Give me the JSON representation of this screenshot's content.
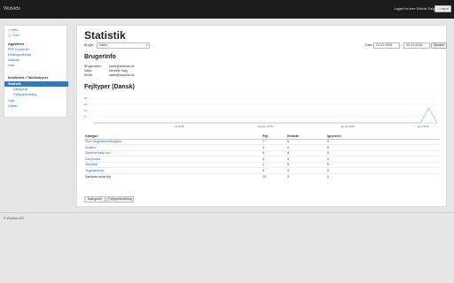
{
  "topbar": {
    "brand": "Wizkids",
    "login_text": "Logget ind som Wizkids Salg",
    "logout_label": "⎋ Log ud"
  },
  "sidebar": {
    "home": "⌂ Hjem",
    "kurv": "🛒 Kurv",
    "section1": "AppWriter",
    "items1": [
      "PDF Konverter",
      "Ordbogsværktøj",
      "Statistik",
      "Hold"
    ],
    "section2": "IntoWords / TaleAnalyser",
    "active": "Statistik",
    "subitems": [
      "Kategorier",
      "Fejltypefordeling"
    ],
    "items2": [
      "Hold",
      "Opsæt"
    ]
  },
  "main": {
    "title": "Statistik",
    "filter_label": "Bruger",
    "filter_value": "Sales",
    "date_label": "Dato:",
    "date_from": "01-01-2016",
    "date_to": "30-04-2016",
    "update_button": "Opdater",
    "user_info_heading": "BrugerInfo",
    "info": [
      {
        "label": "Brugernavn:",
        "value": "sales@wizkids.dk"
      },
      {
        "label": "Navn:",
        "value": "Wizkids Salg"
      },
      {
        "label": "Email:",
        "value": "sales@wizkids.dk"
      }
    ],
    "error_heading": "Fejltyper (Dansk)"
  },
  "chart_data": {
    "type": "line",
    "title": "",
    "xlabel": "",
    "ylabel": "",
    "ylim": [
      0,
      20
    ],
    "y_ticks": [
      "20",
      "15",
      "10",
      "5"
    ],
    "x_ticks": [
      "juli 2015",
      "oktober 2015",
      "januar 2016",
      "april 2016"
    ],
    "series": [
      {
        "values": [
          0,
          0,
          0,
          0,
          0,
          0,
          0,
          0,
          0,
          0,
          0,
          0,
          0,
          0,
          0,
          0,
          0,
          0,
          0,
          0,
          0,
          0,
          0,
          0,
          0,
          0,
          0,
          0,
          0,
          0,
          0,
          0,
          0,
          0,
          0,
          0,
          0,
          0,
          0,
          0,
          12,
          0
        ]
      }
    ],
    "color": "#9fc5e8"
  },
  "table": {
    "headers": [
      "Kategori",
      "Fejl",
      "Rettede",
      "Ignoreret"
    ],
    "rows": [
      [
        "Stort begyndelsesbogstav",
        "7",
        "0",
        "0"
      ],
      [
        "Nutids-r",
        "4",
        "0",
        "0"
      ],
      [
        "Sammensatte ord",
        "0",
        "0",
        "0"
      ],
      [
        "Komposita",
        "0",
        "0",
        "0"
      ],
      [
        "Stavefejl",
        "1",
        "0",
        "0"
      ],
      [
        "Tegnsætning",
        "0",
        "0",
        "0"
      ],
      [
        "Samlede antal fejl",
        "13",
        "0",
        "0"
      ]
    ]
  },
  "tabs": [
    "Kategorier",
    "Fejltypefordeling"
  ],
  "footer": "© Wizkids A/S"
}
